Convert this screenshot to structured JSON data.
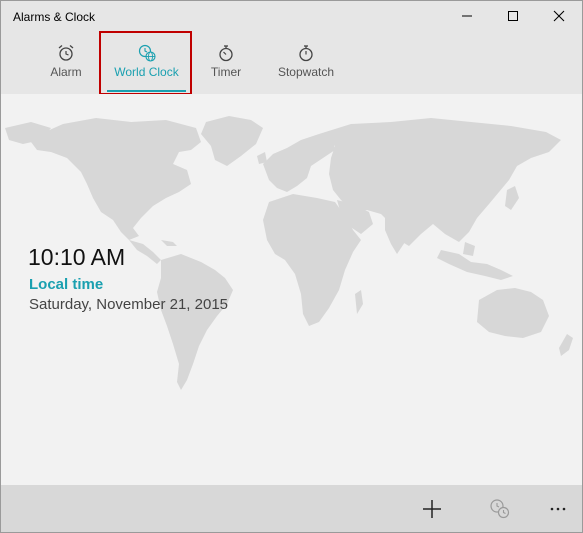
{
  "window": {
    "title": "Alarms & Clock"
  },
  "tabs": [
    {
      "label": "Alarm",
      "icon": "alarm-clock-icon",
      "active": false
    },
    {
      "label": "World Clock",
      "icon": "world-clock-icon",
      "active": true
    },
    {
      "label": "Timer",
      "icon": "timer-icon",
      "active": false
    },
    {
      "label": "Stopwatch",
      "icon": "stopwatch-icon",
      "active": false
    }
  ],
  "clock": {
    "time": "10:10 AM",
    "location_label": "Local time",
    "date": "Saturday, November 21, 2015"
  },
  "commands": [
    "add-icon",
    "compare-clocks-icon",
    "more-icon"
  ],
  "colors": {
    "accent": "#1aa0b0",
    "map_land": "#d7d7d7",
    "background": "#f2f2f2",
    "highlight": "#c00000"
  }
}
